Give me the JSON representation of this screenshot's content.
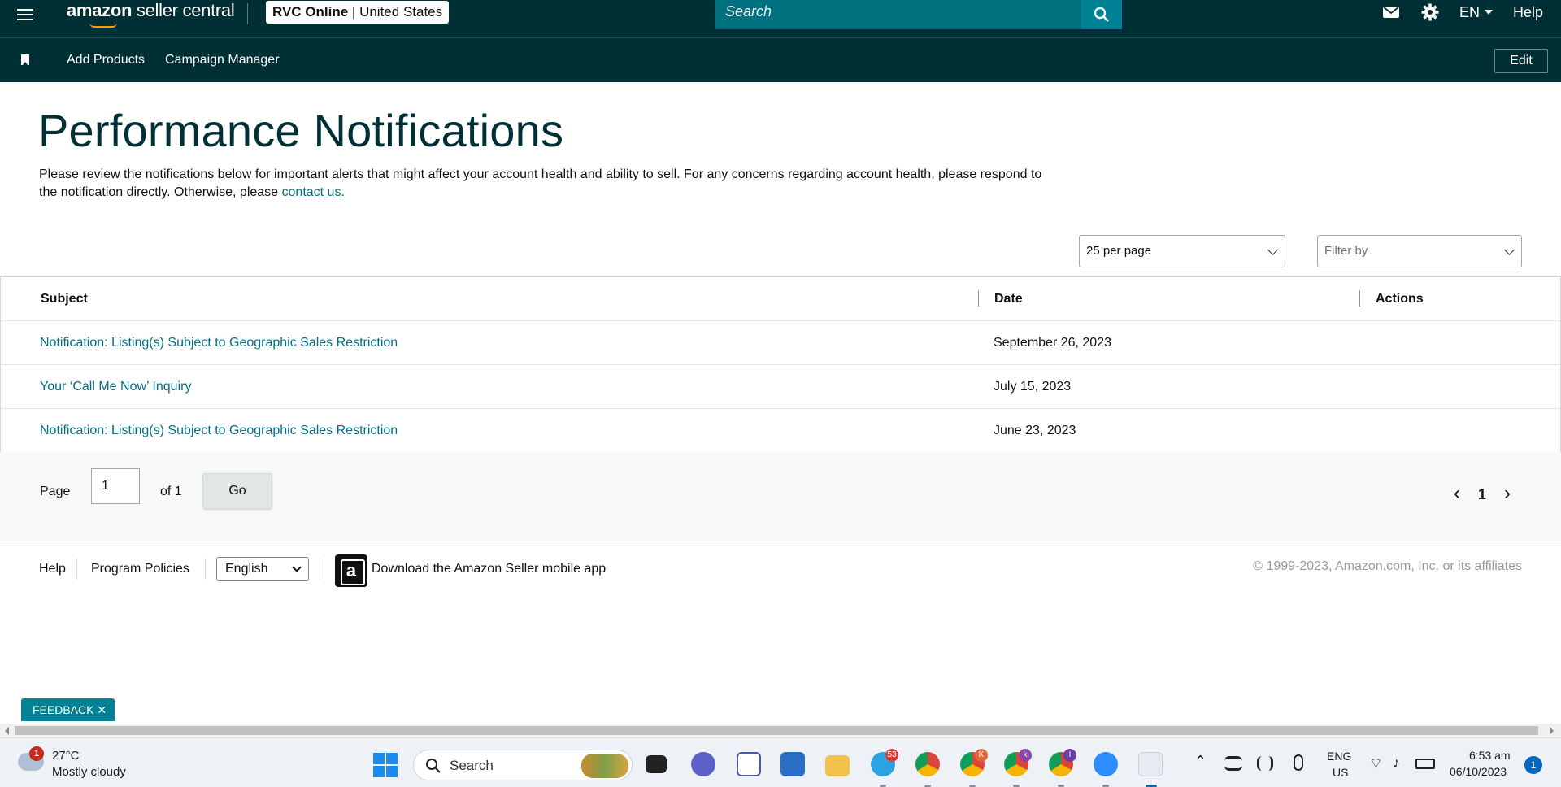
{
  "topbar": {
    "logo_brand": "amazon",
    "logo_product": "seller central",
    "store_name": "RVC Online",
    "store_region": "United States",
    "search_placeholder": "Search",
    "language": "EN",
    "help": "Help"
  },
  "navbar": {
    "links": [
      "Add Products",
      "Campaign Manager"
    ],
    "edit_label": "Edit"
  },
  "main": {
    "title": "Performance Notifications",
    "intro_text": "Please review the notifications below for important alerts that might affect your account health and ability to sell. For any concerns regarding account health, please respond to the notification directly. Otherwise, please ",
    "intro_link": "contact us."
  },
  "controls": {
    "per_page": "25 per page",
    "filter_placeholder": "Filter by"
  },
  "table": {
    "columns": [
      "Subject",
      "Date",
      "Actions"
    ],
    "rows": [
      {
        "subject": "Notification: Listing(s) Subject to Geographic Sales Restriction",
        "date": "September 26, 2023",
        "actions": ""
      },
      {
        "subject": "Your ‘Call Me Now’ Inquiry",
        "date": "July 15, 2023",
        "actions": ""
      },
      {
        "subject": "Notification: Listing(s) Subject to Geographic Sales Restriction",
        "date": "June 23, 2023",
        "actions": ""
      }
    ]
  },
  "pagination": {
    "page_label": "Page",
    "page_value": "1",
    "of_label": "of 1",
    "go_label": "Go",
    "current_page": "1",
    "prev_glyph": "‹",
    "next_glyph": "›"
  },
  "footer": {
    "links": [
      "Help",
      "Program Policies"
    ],
    "language_select": "English",
    "app_text": "Download the Amazon Seller mobile app",
    "copyright": "© 1999-2023, Amazon.com, Inc. or its affiliates"
  },
  "feedback": {
    "label": "FEEDBACK ✕"
  },
  "taskbar": {
    "weather_badge": "1",
    "temperature": "27°C",
    "condition": "Mostly cloudy",
    "search_label": "Search",
    "telegram_badge": "53",
    "chrome_badges": [
      "K",
      "k",
      "I"
    ],
    "lang_line1": "ENG",
    "lang_line2": "US",
    "time": "6:53 am",
    "date": "06/10/2023",
    "notification_count": "1"
  },
  "colors": {
    "header_bg": "#002f36",
    "link": "#007185",
    "accent": "#008296"
  }
}
